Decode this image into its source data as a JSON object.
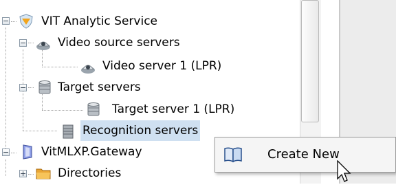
{
  "tree": {
    "nodes": [
      {
        "label": "VIT Analytic Service",
        "expander": "−",
        "icon": "shield-icon"
      },
      {
        "label": "Video source servers",
        "expander": "−",
        "icon": "camera-icon"
      },
      {
        "label": "Video server 1 (LPR)",
        "icon": "camera-icon"
      },
      {
        "label": "Target servers",
        "expander": "−",
        "icon": "database-icon"
      },
      {
        "label": "Target server 1 (LPR)",
        "icon": "database-icon"
      },
      {
        "label": "Recognition servers",
        "icon": "server-rack-icon"
      },
      {
        "label": "VitMLXP.Gateway",
        "expander": "−",
        "icon": "gateway-icon"
      },
      {
        "label": "Directories",
        "expander": "+",
        "icon": "folder-icon"
      }
    ]
  },
  "context_menu": {
    "items": [
      {
        "label": "Create New",
        "icon": "book-icon"
      }
    ]
  },
  "colors": {
    "selection": "#cfe0f1",
    "menu_background": "#f5f5f5",
    "panel_background": "#ececec"
  }
}
